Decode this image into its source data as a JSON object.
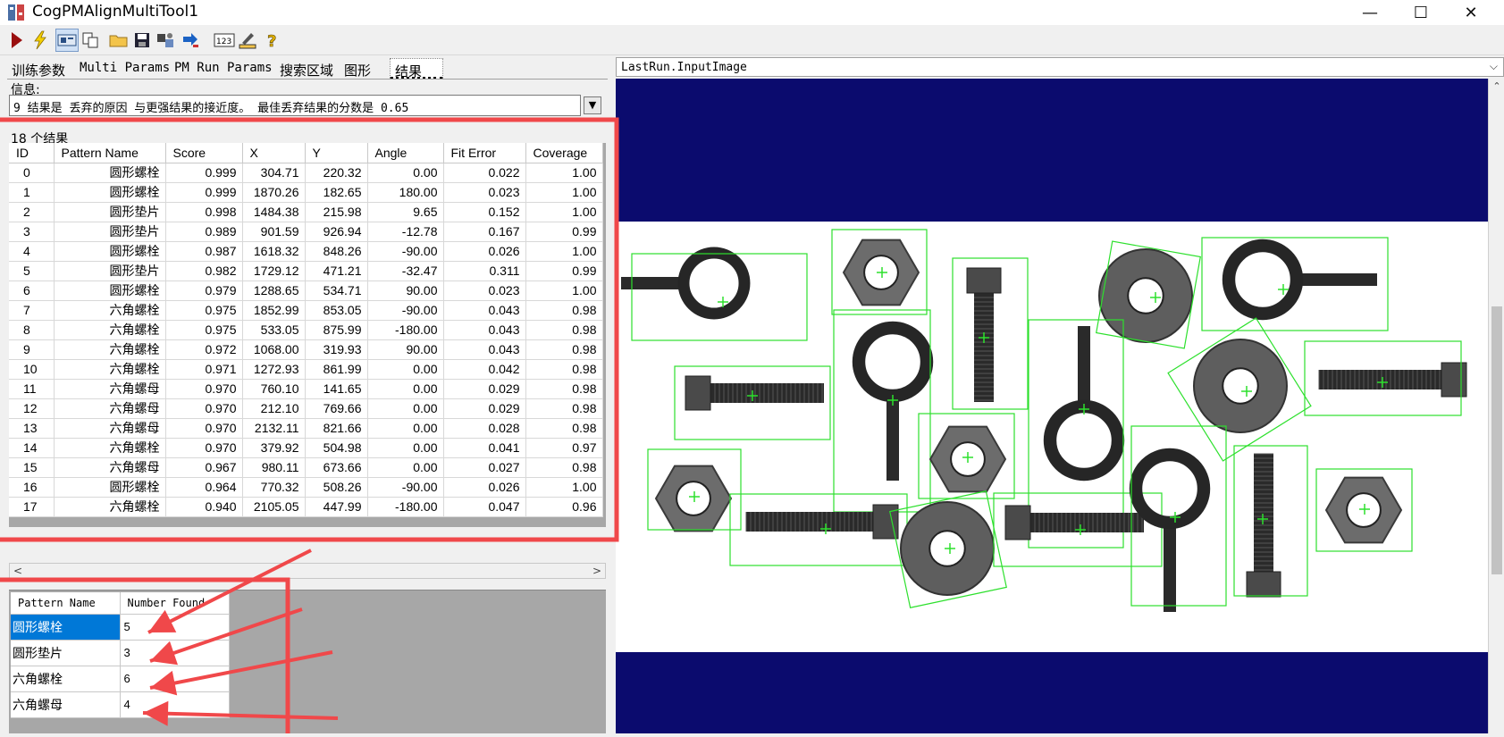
{
  "window": {
    "title": "CogPMAlignMultiTool1",
    "minimize": "—",
    "maximize": "☐",
    "close": "✕"
  },
  "toolbar": {
    "icons": [
      "run-icon",
      "lightning-icon",
      "display-toggle-icon",
      "copy-icon",
      "open-folder-icon",
      "save-icon",
      "settings-icon",
      "import-icon",
      "counter-123-icon",
      "edit-icon",
      "help-icon"
    ]
  },
  "tabs": [
    {
      "label": "训练参数"
    },
    {
      "label": "Multi Params"
    },
    {
      "label": "PM Run Params"
    },
    {
      "label": "搜索区域"
    },
    {
      "label": "图形"
    },
    {
      "label": "结果"
    }
  ],
  "info": {
    "label": "信息:",
    "message": "9 结果是 丢弃的原因 与更强结果的接近度。  最佳丢弃结果的分数是 0.65"
  },
  "results": {
    "count_label": "18 个结果",
    "columns": [
      "ID",
      "Pattern Name",
      "Score",
      "X",
      "Y",
      "Angle",
      "Fit Error",
      "Coverage"
    ],
    "rows": [
      [
        "0",
        "圆形螺栓",
        "0.999",
        "304.71",
        "220.32",
        "0.00",
        "0.022",
        "1.00"
      ],
      [
        "1",
        "圆形螺栓",
        "0.999",
        "1870.26",
        "182.65",
        "180.00",
        "0.023",
        "1.00"
      ],
      [
        "2",
        "圆形垫片",
        "0.998",
        "1484.38",
        "215.98",
        "9.65",
        "0.152",
        "1.00"
      ],
      [
        "3",
        "圆形垫片",
        "0.989",
        "901.59",
        "926.94",
        "-12.78",
        "0.167",
        "0.99"
      ],
      [
        "4",
        "圆形螺栓",
        "0.987",
        "1618.32",
        "848.26",
        "-90.00",
        "0.026",
        "1.00"
      ],
      [
        "5",
        "圆形垫片",
        "0.982",
        "1729.12",
        "471.21",
        "-32.47",
        "0.311",
        "0.99"
      ],
      [
        "6",
        "圆形螺栓",
        "0.979",
        "1288.65",
        "534.71",
        "90.00",
        "0.023",
        "1.00"
      ],
      [
        "7",
        "六角螺栓",
        "0.975",
        "1852.99",
        "853.05",
        "-90.00",
        "0.043",
        "0.98"
      ],
      [
        "8",
        "六角螺栓",
        "0.975",
        "533.05",
        "875.99",
        "-180.00",
        "0.043",
        "0.98"
      ],
      [
        "9",
        "六角螺栓",
        "0.972",
        "1068.00",
        "319.93",
        "90.00",
        "0.043",
        "0.98"
      ],
      [
        "10",
        "六角螺栓",
        "0.971",
        "1272.93",
        "861.99",
        "0.00",
        "0.042",
        "0.98"
      ],
      [
        "11",
        "六角螺母",
        "0.970",
        "760.10",
        "141.65",
        "0.00",
        "0.029",
        "0.98"
      ],
      [
        "12",
        "六角螺母",
        "0.970",
        "212.10",
        "769.66",
        "0.00",
        "0.029",
        "0.98"
      ],
      [
        "13",
        "六角螺母",
        "0.970",
        "2132.11",
        "821.66",
        "0.00",
        "0.028",
        "0.98"
      ],
      [
        "14",
        "六角螺栓",
        "0.970",
        "379.92",
        "504.98",
        "0.00",
        "0.041",
        "0.97"
      ],
      [
        "15",
        "六角螺母",
        "0.967",
        "980.11",
        "673.66",
        "0.00",
        "0.027",
        "0.98"
      ],
      [
        "16",
        "圆形螺栓",
        "0.964",
        "770.32",
        "508.26",
        "-90.00",
        "0.026",
        "1.00"
      ],
      [
        "17",
        "六角螺栓",
        "0.940",
        "2105.05",
        "447.99",
        "-180.00",
        "0.047",
        "0.96"
      ]
    ]
  },
  "summary": {
    "columns": [
      "Pattern Name",
      "Number Found"
    ],
    "rows": [
      {
        "name": "圆形螺栓",
        "count": "5"
      },
      {
        "name": "圆形垫片",
        "count": "3"
      },
      {
        "name": "六角螺栓",
        "count": "6"
      },
      {
        "name": "六角螺母",
        "count": "4"
      }
    ]
  },
  "image_panel": {
    "title": "LastRun.InputImage",
    "colors": {
      "border_band": "#0b0b6e",
      "bbox": "#2de02d",
      "background": "#ffffff"
    }
  },
  "annotation": {
    "color": "#f0484a"
  }
}
